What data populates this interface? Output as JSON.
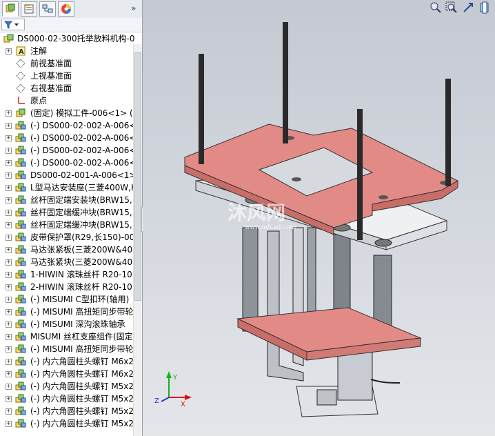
{
  "tree": {
    "root": "DS000-02-300托举放料机构-0",
    "items": [
      {
        "label": "注解",
        "icon": "annotation-icon",
        "expand": true
      },
      {
        "label": "前视基准面",
        "icon": "plane-icon",
        "expand": false
      },
      {
        "label": "上视基准面",
        "icon": "plane-icon",
        "expand": false
      },
      {
        "label": "右视基准面",
        "icon": "plane-icon",
        "expand": false
      },
      {
        "label": "原点",
        "icon": "origin-icon",
        "expand": false
      },
      {
        "label": "(固定) 模拟工件-006<1> (",
        "icon": "part-icon",
        "expand": true
      },
      {
        "label": "(-) DS000-02-002-A-006<",
        "icon": "assembly-icon",
        "expand": true
      },
      {
        "label": "(-) DS000-02-002-A-006<",
        "icon": "assembly-icon",
        "expand": true
      },
      {
        "label": "(-) DS000-02-002-A-006<",
        "icon": "assembly-icon",
        "expand": true
      },
      {
        "label": "(-) DS000-02-002-A-006<",
        "icon": "assembly-icon",
        "expand": true
      },
      {
        "label": "DS000-02-001-A-006<1>",
        "icon": "assembly-icon",
        "expand": true
      },
      {
        "label": "L型马达安装座(三菱400W,H",
        "icon": "assembly-icon",
        "expand": true
      },
      {
        "label": "丝杆固定端安装块(BRW15,",
        "icon": "assembly-icon",
        "expand": true
      },
      {
        "label": "丝杆固定端缓冲块(BRW15,",
        "icon": "assembly-icon",
        "expand": true
      },
      {
        "label": "丝杆固定端缓冲块(BRW15,",
        "icon": "assembly-icon",
        "expand": true
      },
      {
        "label": "皮带保护罩(R29,长150)-00",
        "icon": "assembly-icon",
        "expand": true
      },
      {
        "label": "马达张紧板(三菱200W&400",
        "icon": "assembly-icon",
        "expand": true
      },
      {
        "label": "马达张紧块(三菱200W&40",
        "icon": "assembly-icon",
        "expand": true
      },
      {
        "label": "1-HIWIN 滚珠丝杆 R20-10",
        "icon": "assembly-icon",
        "expand": true
      },
      {
        "label": "2-HIWIN 滚珠丝杆 R20-10",
        "icon": "assembly-icon",
        "expand": true
      },
      {
        "label": "(-) MISUMI C型扣环(轴用)",
        "icon": "assembly-icon",
        "expand": true
      },
      {
        "label": "(-) MISUMI 高扭矩同步带轮",
        "icon": "assembly-icon",
        "expand": true
      },
      {
        "label": "(-) MISUMI 深沟滚珠轴承",
        "icon": "assembly-icon",
        "expand": true
      },
      {
        "label": "MISUMI 丝杠支座组件(固定",
        "icon": "assembly-icon",
        "expand": true
      },
      {
        "label": "(-) MISUMI 高扭矩同步带轮",
        "icon": "assembly-icon",
        "expand": true
      },
      {
        "label": "(-) 内六角圆柱头螺钉 M6x2",
        "icon": "assembly-icon",
        "expand": true
      },
      {
        "label": "(-) 内六角圆柱头螺钉 M6x2",
        "icon": "assembly-icon",
        "expand": true
      },
      {
        "label": "(-) 内六角圆柱头螺钉 M5x2",
        "icon": "assembly-icon",
        "expand": true
      },
      {
        "label": "(-) 内六角圆柱头螺钉 M5x2",
        "icon": "assembly-icon",
        "expand": true
      },
      {
        "label": "(-) 内六角圆柱头螺钉 M5x2",
        "icon": "assembly-icon",
        "expand": true
      },
      {
        "label": "(-) 内六角圆柱头螺钉 M5x2",
        "icon": "assembly-icon",
        "expand": true
      }
    ]
  },
  "watermark": {
    "main": "沐风网",
    "sub": "www.mfcad.com"
  },
  "triad": {
    "x": "X",
    "y": "Y",
    "z": "Z"
  },
  "colors": {
    "plate_red": "#e28a86",
    "plate_white": "#eef0f2",
    "metal": "#b8bcc2",
    "rod": "#2a2a2a"
  }
}
